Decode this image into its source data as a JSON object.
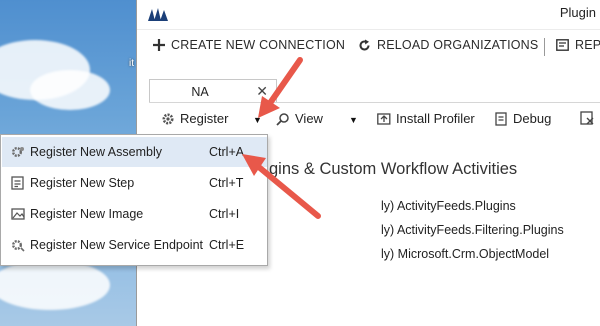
{
  "desktop": {
    "label_fragment": "it"
  },
  "window": {
    "title": "Plugin"
  },
  "toolbar": {
    "create_connection": "CREATE NEW CONNECTION",
    "reload_organizations": "RELOAD ORGANIZATIONS",
    "report_fragment": "REP"
  },
  "tab": {
    "label": "NA",
    "close": "✕"
  },
  "inner_toolbar": {
    "register": "Register",
    "view": "View",
    "install_profiler": "Install Profiler",
    "debug": "Debug"
  },
  "content": {
    "heading": "gins & Custom Workflow Activities",
    "assemblies": [
      "ly) ActivityFeeds.Plugins",
      "ly) ActivityFeeds.Filtering.Plugins",
      "ly) Microsoft.Crm.ObjectModel"
    ]
  },
  "menu": {
    "items": [
      {
        "label": "Register New Assembly",
        "shortcut": "Ctrl+A",
        "icon": "assembly-gear-icon",
        "highlighted": true
      },
      {
        "label": "Register New Step",
        "shortcut": "Ctrl+T",
        "icon": "step-icon",
        "highlighted": false
      },
      {
        "label": "Register New Image",
        "shortcut": "Ctrl+I",
        "icon": "image-icon",
        "highlighted": false
      },
      {
        "label": "Register New Service Endpoint",
        "shortcut": "Ctrl+E",
        "icon": "endpoint-gear-icon",
        "highlighted": false
      }
    ]
  },
  "colors": {
    "arrow": "#e8584a",
    "highlight": "#dfe9f5",
    "logo": "#1b3f78"
  }
}
